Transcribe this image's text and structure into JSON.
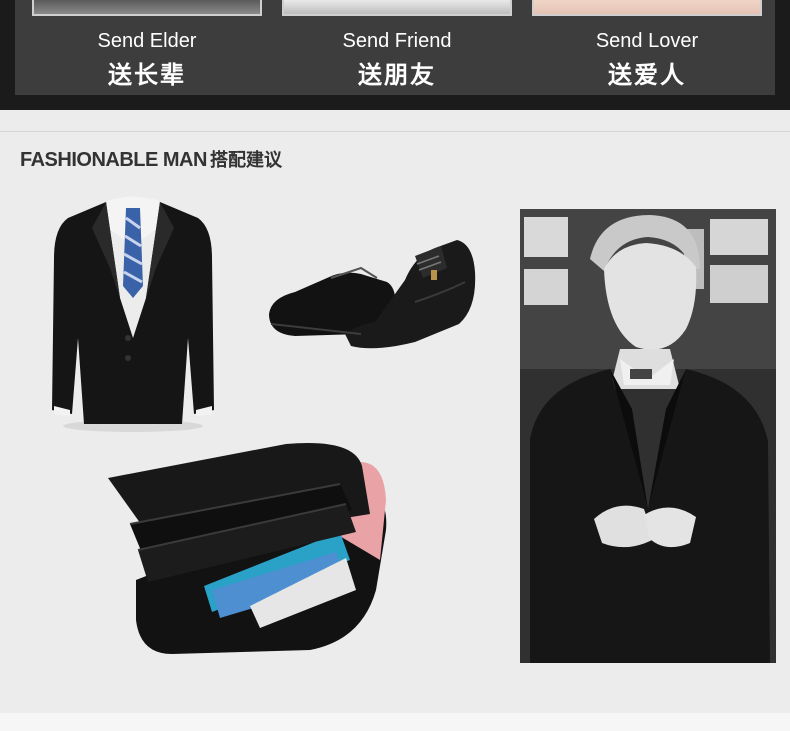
{
  "gifts": [
    {
      "en": "Send Elder",
      "cn": "送长辈"
    },
    {
      "en": "Send Friend",
      "cn": "送朋友"
    },
    {
      "en": "Send Lover",
      "cn": "送爱人"
    }
  ],
  "section": {
    "title_en": "FASHIONABLE MAN",
    "title_cn": "搭配建议"
  },
  "colors": {
    "dark_band": "#1b1b1b",
    "panel": "#3d3d3d",
    "background": "#ececec"
  },
  "icons": [
    "suit-jacket",
    "leather-shoes",
    "leather-wallet",
    "model-photo"
  ]
}
